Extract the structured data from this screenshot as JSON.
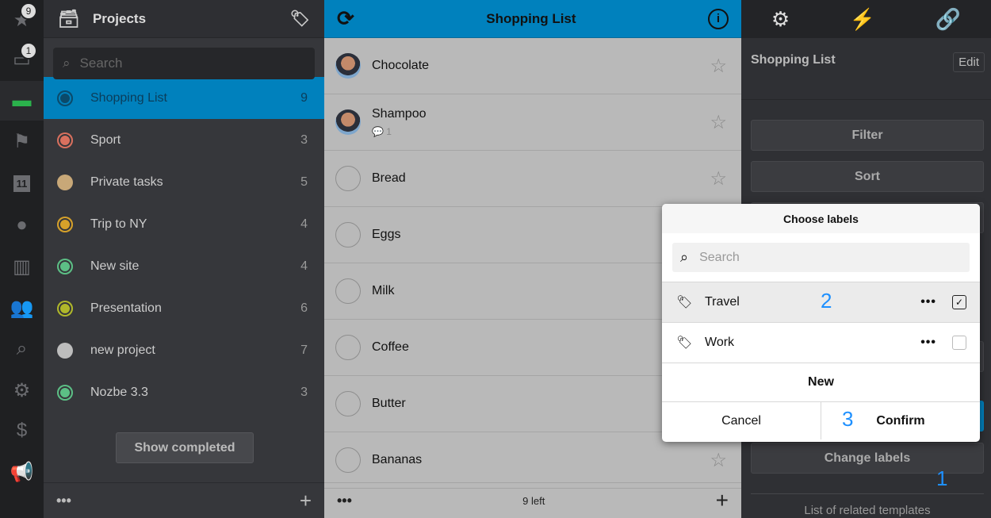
{
  "rail": {
    "items": [
      {
        "icon": "star-icon",
        "glyph": "★",
        "badge": "9"
      },
      {
        "icon": "inbox-icon",
        "glyph": "▭",
        "badge": "1"
      },
      {
        "icon": "projects-icon",
        "glyph": "▬",
        "active": true
      },
      {
        "icon": "flag-icon",
        "glyph": "⚑"
      },
      {
        "icon": "calendar-icon",
        "glyph": "11"
      },
      {
        "icon": "comments-icon",
        "glyph": "●"
      },
      {
        "icon": "templates-icon",
        "glyph": "▥"
      },
      {
        "icon": "team-icon",
        "glyph": "👥"
      },
      {
        "icon": "search-icon",
        "glyph": "⌕"
      },
      {
        "icon": "settings-icon",
        "glyph": "⚙"
      },
      {
        "icon": "billing-icon",
        "glyph": "$"
      },
      {
        "icon": "megaphone-icon",
        "glyph": "📢"
      }
    ]
  },
  "projects": {
    "title": "Projects",
    "search_placeholder": "Search",
    "show_completed": "Show completed",
    "items": [
      {
        "name": "Shopping List",
        "count": "9",
        "color": "#0b4a6a",
        "ring": true,
        "selected": true
      },
      {
        "name": "Sport",
        "count": "3",
        "color": "#d9705e",
        "ring": true
      },
      {
        "name": "Private tasks",
        "count": "5",
        "color": "#c8a878",
        "ring": false
      },
      {
        "name": "Trip to NY",
        "count": "4",
        "color": "#d6a12a",
        "ring": true
      },
      {
        "name": "New site",
        "count": "4",
        "color": "#5cbf85",
        "ring": true
      },
      {
        "name": "Presentation",
        "count": "6",
        "color": "#b0b82a",
        "ring": true
      },
      {
        "name": "new project",
        "count": "7",
        "color": "#bdbdbd",
        "ring": false
      },
      {
        "name": "Nozbe 3.3",
        "count": "3",
        "color": "#5cbf85",
        "ring": true
      }
    ]
  },
  "list": {
    "title": "Shopping List",
    "footer_count": "9 left",
    "tasks": [
      {
        "name": "Chocolate",
        "avatar": true
      },
      {
        "name": "Shampoo",
        "avatar": true,
        "comments": "1"
      },
      {
        "name": "Bread"
      },
      {
        "name": "Eggs"
      },
      {
        "name": "Milk"
      },
      {
        "name": "Coffee"
      },
      {
        "name": "Butter"
      },
      {
        "name": "Bananas"
      }
    ]
  },
  "details": {
    "title": "Shopping List",
    "edit": "Edit",
    "filter": "Filter",
    "sort": "Sort",
    "change_labels": "Change labels",
    "related": "List of related templates",
    "step1": "1"
  },
  "modal": {
    "title": "Choose labels",
    "search_placeholder": "Search",
    "labels": [
      {
        "name": "Travel",
        "checked": true,
        "step": "2"
      },
      {
        "name": "Work",
        "checked": false
      }
    ],
    "new": "New",
    "cancel": "Cancel",
    "confirm": "Confirm",
    "step3": "3"
  },
  "colors": {
    "accent": "#0081bd",
    "step_number": "#1e90ff"
  }
}
